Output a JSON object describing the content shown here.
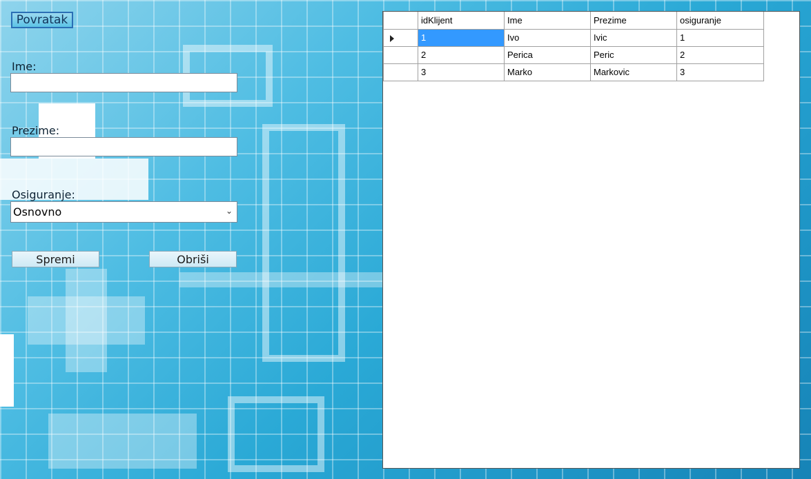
{
  "toolbar": {
    "back_label": "Povratak"
  },
  "form": {
    "ime_label": "Ime:",
    "ime_value": "",
    "prezime_label": "Prezime:",
    "prezime_value": "",
    "osiguranje_label": "Osiguranje:",
    "osiguranje_selected": "Osnovno",
    "save_label": "Spremi",
    "delete_label": "Obriši"
  },
  "grid": {
    "columns": [
      "idKlijent",
      "Ime",
      "Prezime",
      "osiguranje"
    ],
    "rows": [
      [
        "1",
        "Ivo",
        "Ivic",
        "1"
      ],
      [
        "2",
        "Perica",
        "Peric",
        "2"
      ],
      [
        "3",
        "Marko",
        "Markovic",
        "3"
      ]
    ],
    "selected_row": 0
  },
  "colors": {
    "background": "#2aa9d6",
    "selection": "#3399ff"
  }
}
